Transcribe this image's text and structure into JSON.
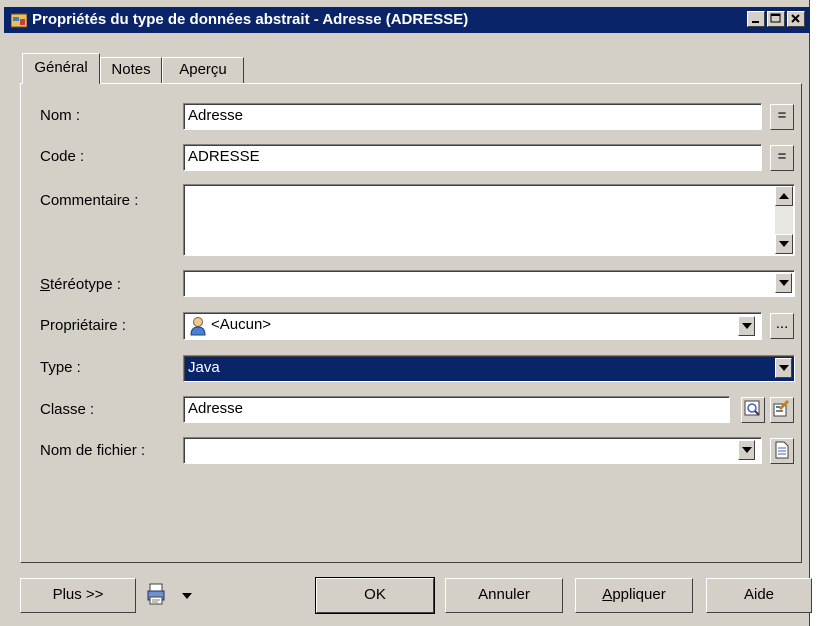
{
  "window": {
    "title": "Propriétés du type de données abstrait - Adresse (ADRESSE)",
    "icon": "datatype-icon",
    "controls": [
      "minimize-icon",
      "maximize-icon",
      "close-icon"
    ]
  },
  "tabs": [
    {
      "label": "Général",
      "active": true
    },
    {
      "label": "Notes",
      "active": false
    },
    {
      "label": "Aperçu",
      "active": false
    }
  ],
  "form": {
    "nom": {
      "label": "Nom :",
      "value": "Adresse",
      "button": "="
    },
    "code": {
      "label": "Code :",
      "value": "ADRESSE",
      "button": "="
    },
    "commentaire": {
      "label": "Commentaire :",
      "value": ""
    },
    "stereotype": {
      "label": "Stéréotype :",
      "value": ""
    },
    "proprietaire": {
      "label": "Propriétaire :",
      "value": "<Aucun>",
      "button": "..."
    },
    "type": {
      "label": "Type :",
      "value": "Java"
    },
    "classe": {
      "label": "Classe :",
      "value": "Adresse"
    },
    "nom_fichier": {
      "label": "Nom de fichier :",
      "value": ""
    }
  },
  "buttons": {
    "plus": "Plus >>",
    "ok": "OK",
    "annuler": "Annuler",
    "appliquer": "Appliquer",
    "aide": "Aide"
  },
  "colors": {
    "titlebar": "#0a246a",
    "dialog_bg": "#d4d0c8",
    "selection": "#0a246a"
  }
}
